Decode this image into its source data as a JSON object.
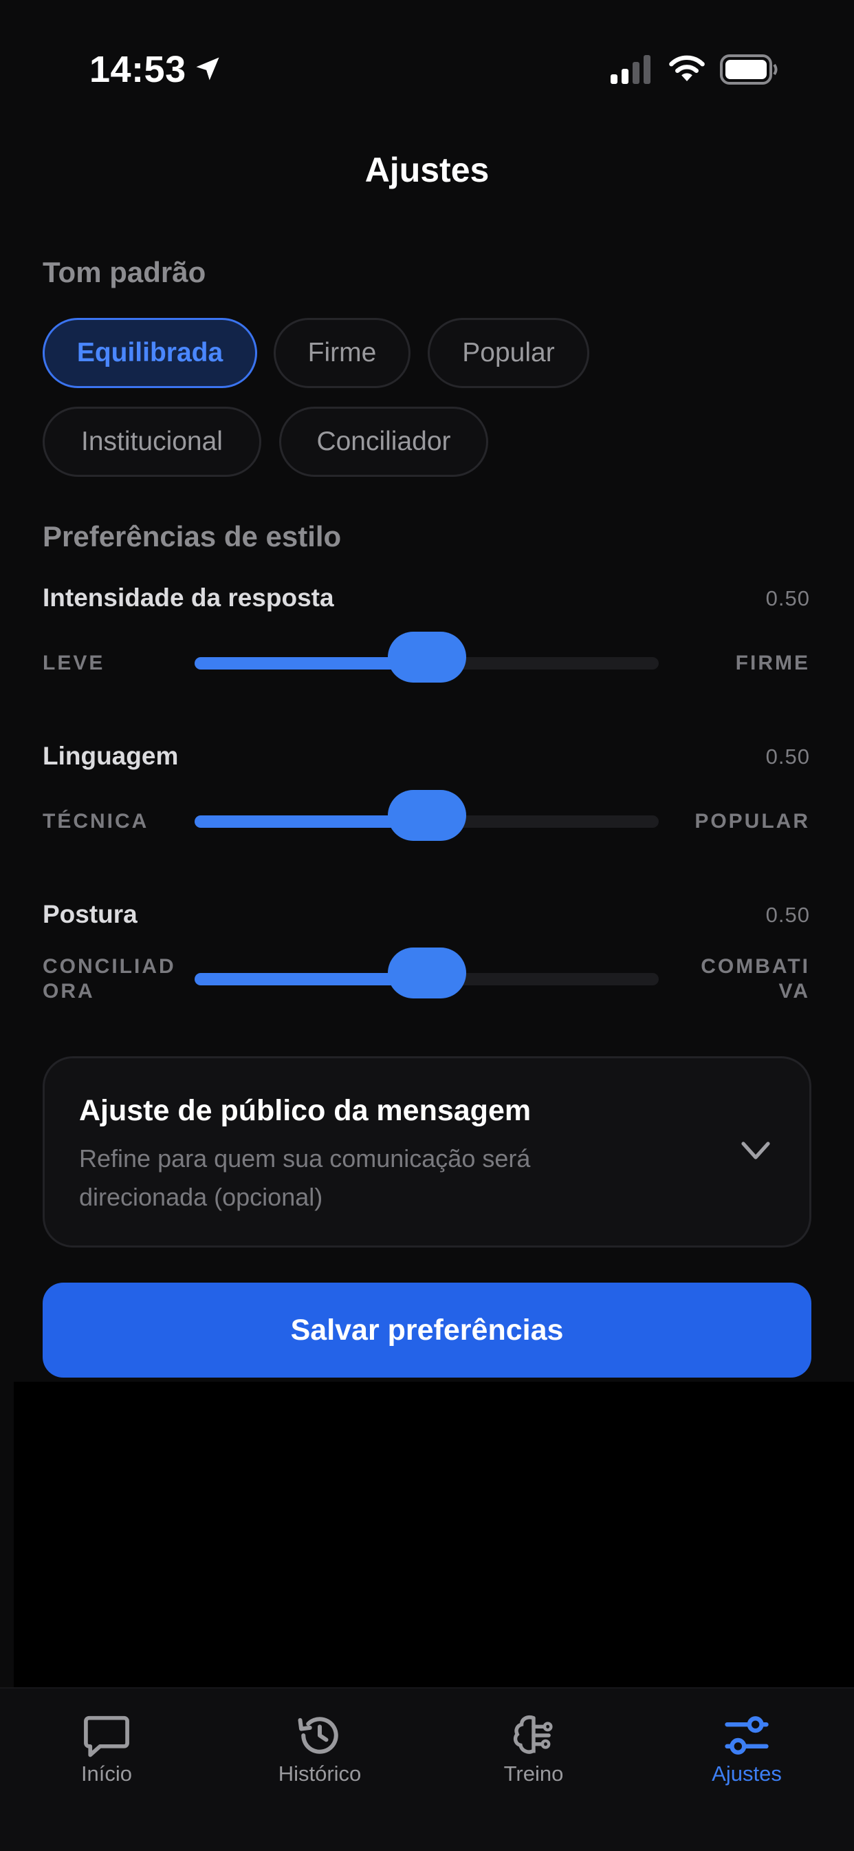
{
  "status_bar": {
    "time": "14:53"
  },
  "header": {
    "title": "Ajustes"
  },
  "tone": {
    "title": "Tom padrão",
    "options": [
      "Equilibrada",
      "Firme",
      "Popular",
      "Institucional",
      "Conciliador"
    ],
    "selected": "Equilibrada"
  },
  "style": {
    "title": "Preferências de estilo",
    "sliders": [
      {
        "label": "Intensidade da resposta",
        "value": "0.50",
        "min_label": "LEVE",
        "max_label": "FIRME",
        "level": 0.5
      },
      {
        "label": "Linguagem",
        "value": "0.50",
        "min_label": "TÉCNICA",
        "max_label": "POPULAR",
        "level": 0.5
      },
      {
        "label": "Postura",
        "value": "0.50",
        "min_label": "CONCILIADORA",
        "max_label": "COMBATIVA",
        "level": 0.5
      }
    ]
  },
  "audience": {
    "title": "Ajuste de público da mensagem",
    "description": "Refine para quem sua comunicação será direcionada (opcional)"
  },
  "save_label": "Salvar preferências",
  "tabs": [
    {
      "label": "Início",
      "icon": "chat-bubble-icon"
    },
    {
      "label": "Histórico",
      "icon": "history-icon"
    },
    {
      "label": "Treino",
      "icon": "brain-circuit-icon"
    },
    {
      "label": "Ajustes",
      "icon": "settings-sliders-icon",
      "active": true
    }
  ],
  "colors": {
    "accent": "#2463e8",
    "accent_text": "#4a87ff",
    "background": "#0b0b0c"
  }
}
